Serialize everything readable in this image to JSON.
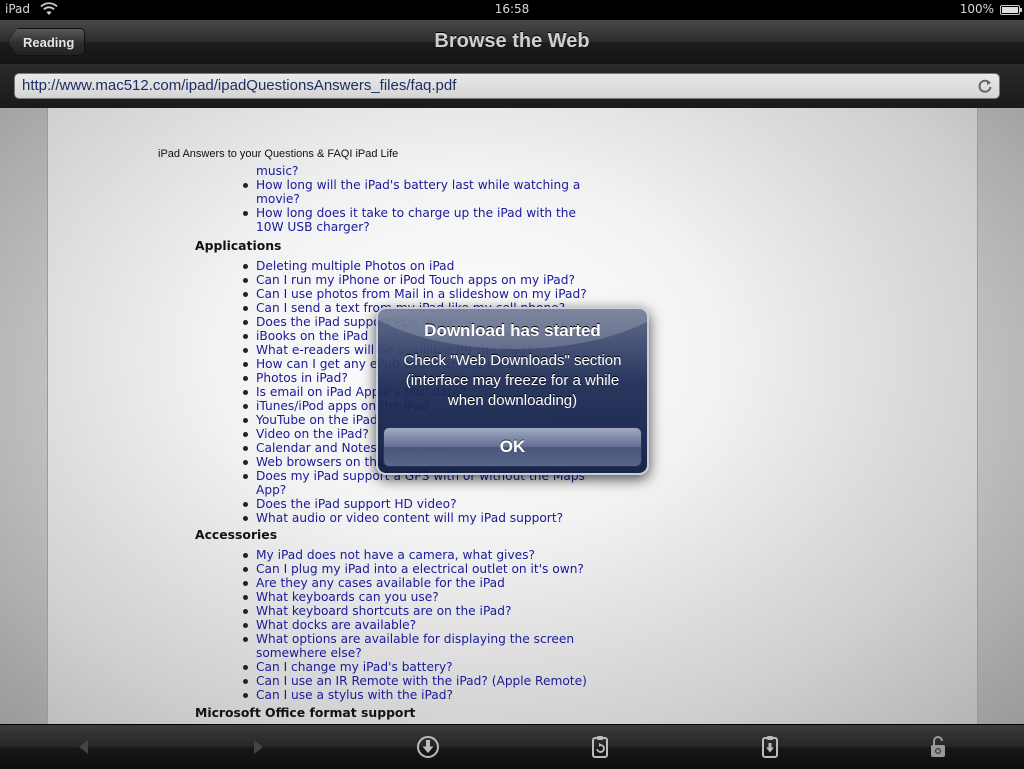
{
  "status_bar": {
    "carrier": "iPad",
    "time": "16:58",
    "battery": "100%"
  },
  "nav": {
    "back_label": "Reading",
    "title": "Browse the Web"
  },
  "url_bar": {
    "url": "http://www.mac512.com/ipad/ipadQuestionsAnswers_files/faq.pdf"
  },
  "document": {
    "header": "iPad Answers to your Questions & FAQI iPad Life",
    "intro_items": [
      "music?",
      "How long will the iPad's battery last while watching a",
      "movie?",
      "How long does it take to charge up the iPad with the",
      "10W USB charger?"
    ],
    "sections": [
      {
        "heading": "Applications",
        "items": [
          "Deleting multiple Photos on iPad",
          "Can I run my iPhone or iPod Touch apps on my iPad?",
          "Can I use photos from Mail in a slideshow on my iPad?",
          "Can I send a text from my iPad like my cell phone?",
          "Does the iPad support PDF files?",
          "iBooks on the iPad",
          "What e-readers will be available for the iPad?",
          "How can I get any ePub books on the iPad?",
          "Photos in iPad?",
          "Is email on iPad Apple's Mail data?",
          "iTunes/iPod apps on the iPad",
          "YouTube on the iPad",
          "Video on the iPad?",
          "Calendar and Notes on the iPad",
          "Web browsers on the iPad",
          "Does my iPad support a GPS with or without the Maps",
          "App?",
          "Does the iPad support HD video?",
          "What audio or video content will my iPad support?"
        ]
      },
      {
        "heading": "Accessories",
        "items": [
          "My iPad does not have a camera, what gives?",
          "Can I plug my iPad into a electrical outlet on it's own?",
          "Are they any cases available for the iPad",
          "What keyboards can you use?",
          "What keyboard shortcuts are on the iPad?",
          "What docks are available?",
          "What options are available for displaying the screen",
          "somewhere else?",
          "Can I change my iPad's battery?",
          "Can I use an IR Remote with the iPad? (Apple Remote)",
          "Can I use a stylus with the iPad?"
        ]
      },
      {
        "heading": "Microsoft Office format support",
        "items": []
      }
    ]
  },
  "alert": {
    "title": "Download has started",
    "message": "Check \"Web Downloads\" section (interface may freeze for a while when downloading)",
    "ok_label": "OK"
  },
  "toolbar": {
    "icons": [
      "back-arrow-icon",
      "forward-arrow-icon",
      "download-icon",
      "clipboard-icon",
      "clipboard-download-icon",
      "lock-icon"
    ]
  }
}
